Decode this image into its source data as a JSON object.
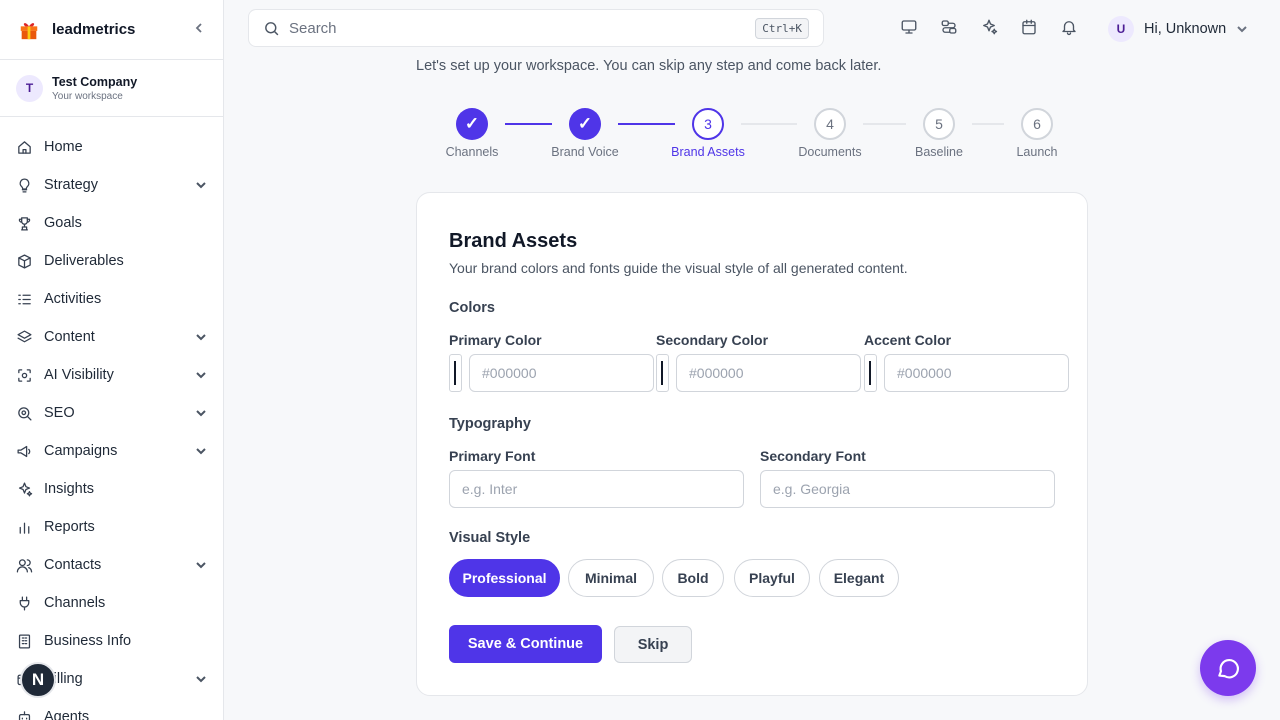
{
  "app": {
    "name": "leadmetrics"
  },
  "workspace": {
    "initial": "T",
    "name": "Test Company",
    "caption": "Your workspace"
  },
  "sidebar": {
    "items": [
      {
        "label": "Home",
        "icon": "home-icon",
        "chevron": false
      },
      {
        "label": "Strategy",
        "icon": "lightbulb-icon",
        "chevron": true
      },
      {
        "label": "Goals",
        "icon": "trophy-icon",
        "chevron": false
      },
      {
        "label": "Deliverables",
        "icon": "package-icon",
        "chevron": false
      },
      {
        "label": "Activities",
        "icon": "list-checks-icon",
        "chevron": false
      },
      {
        "label": "Content",
        "icon": "layers-icon",
        "chevron": true
      },
      {
        "label": "AI Visibility",
        "icon": "scan-icon",
        "chevron": true
      },
      {
        "label": "SEO",
        "icon": "search-zoom-icon",
        "chevron": true
      },
      {
        "label": "Campaigns",
        "icon": "megaphone-icon",
        "chevron": true
      },
      {
        "label": "Insights",
        "icon": "sparkles-icon",
        "chevron": false
      },
      {
        "label": "Reports",
        "icon": "bar-chart-icon",
        "chevron": false
      },
      {
        "label": "Contacts",
        "icon": "users-icon",
        "chevron": true
      },
      {
        "label": "Channels",
        "icon": "plug-icon",
        "chevron": false
      },
      {
        "label": "Business Info",
        "icon": "building-icon",
        "chevron": false
      },
      {
        "label": "Billing",
        "icon": "credit-card-icon",
        "chevron": true
      },
      {
        "label": "Agents",
        "icon": "bot-icon",
        "chevron": false
      }
    ]
  },
  "dev_badge": "N",
  "search": {
    "placeholder": "Search",
    "shortcut": "Ctrl+K"
  },
  "user": {
    "initial": "U",
    "greeting": "Hi, Unknown"
  },
  "intro": "Let's set up your workspace. You can skip any step and come back later.",
  "steps": [
    {
      "num": "1",
      "label": "Channels",
      "state": "done"
    },
    {
      "num": "2",
      "label": "Brand Voice",
      "state": "done"
    },
    {
      "num": "3",
      "label": "Brand Assets",
      "state": "current"
    },
    {
      "num": "4",
      "label": "Documents",
      "state": "todo"
    },
    {
      "num": "5",
      "label": "Baseline",
      "state": "todo"
    },
    {
      "num": "6",
      "label": "Launch",
      "state": "todo"
    }
  ],
  "check_glyph": "✓",
  "card": {
    "title": "Brand Assets",
    "subtitle": "Your brand colors and fonts guide the visual style of all generated content.",
    "colors_heading": "Colors",
    "primary_color": {
      "label": "Primary Color",
      "value": "",
      "placeholder": "#000000"
    },
    "secondary_color": {
      "label": "Secondary Color",
      "value": "",
      "placeholder": "#000000"
    },
    "accent_color": {
      "label": "Accent Color",
      "value": "",
      "placeholder": "#000000"
    },
    "typography_heading": "Typography",
    "primary_font": {
      "label": "Primary Font",
      "value": "",
      "placeholder": "e.g. Inter"
    },
    "secondary_font": {
      "label": "Secondary Font",
      "value": "",
      "placeholder": "e.g. Georgia"
    },
    "visual_style_heading": "Visual Style",
    "styles": [
      "Professional",
      "Minimal",
      "Bold",
      "Playful",
      "Elegant"
    ],
    "selected_style": "Professional",
    "save_label": "Save & Continue",
    "skip_label": "Skip"
  },
  "colors": {
    "accent": "#4f35e8",
    "chat": "#7c3aed"
  }
}
